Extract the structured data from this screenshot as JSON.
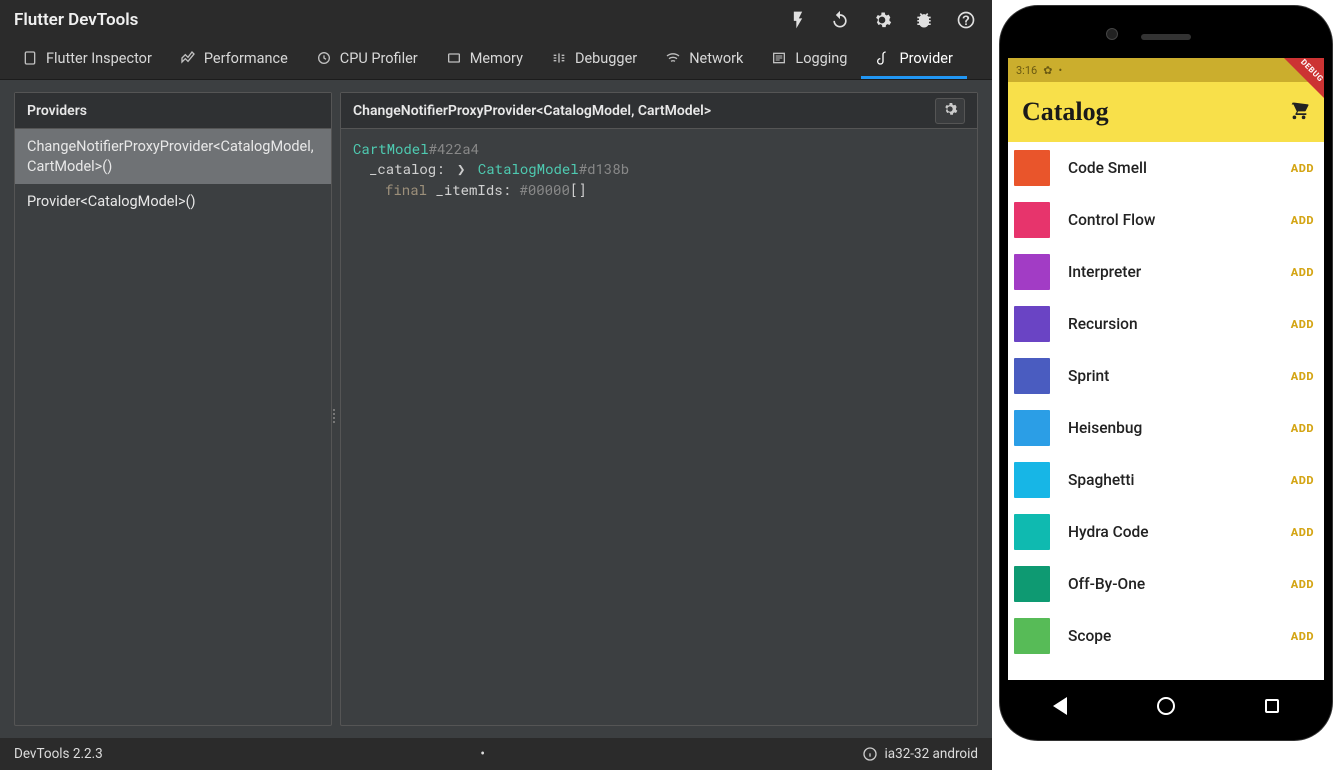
{
  "app_title": "Flutter DevTools",
  "tabs": [
    {
      "label": "Flutter Inspector"
    },
    {
      "label": "Performance"
    },
    {
      "label": "CPU Profiler"
    },
    {
      "label": "Memory"
    },
    {
      "label": "Debugger"
    },
    {
      "label": "Network"
    },
    {
      "label": "Logging"
    },
    {
      "label": "Provider"
    }
  ],
  "providers_panel": {
    "header": "Providers",
    "items": [
      {
        "label": "ChangeNotifierProxyProvider<CatalogModel, CartModel>()",
        "selected": true
      },
      {
        "label": "Provider<CatalogModel>()",
        "selected": false
      }
    ]
  },
  "detail_panel": {
    "header": "ChangeNotifierProxyProvider<CatalogModel, CartModel>",
    "root_type": "CartModel",
    "root_hash": "#422a4",
    "fields": [
      {
        "name": "_catalog:",
        "value_type": "CatalogModel",
        "value_hash": "#d138b",
        "expandable": true
      },
      {
        "keyword": "final ",
        "name": "_itemIds:",
        "value_hash": "#00000",
        "value_suffix": "[]"
      }
    ]
  },
  "statusbar": {
    "version": "DevTools 2.2.3",
    "target": "ia32-32 android"
  },
  "phone": {
    "status_time": "3:16",
    "debug_label": "DEBUG",
    "header_title": "Catalog",
    "add_label": "ADD",
    "items": [
      {
        "name": "Code Smell",
        "color": "#e9552b"
      },
      {
        "name": "Control Flow",
        "color": "#e7346c"
      },
      {
        "name": "Interpreter",
        "color": "#a23cc5"
      },
      {
        "name": "Recursion",
        "color": "#6a44c4"
      },
      {
        "name": "Sprint",
        "color": "#4a5cc0"
      },
      {
        "name": "Heisenbug",
        "color": "#2b9ee6"
      },
      {
        "name": "Spaghetti",
        "color": "#17b6e6"
      },
      {
        "name": "Hydra Code",
        "color": "#0fbab0"
      },
      {
        "name": "Off-By-One",
        "color": "#0e9a72"
      },
      {
        "name": "Scope",
        "color": "#57bb57"
      }
    ]
  }
}
